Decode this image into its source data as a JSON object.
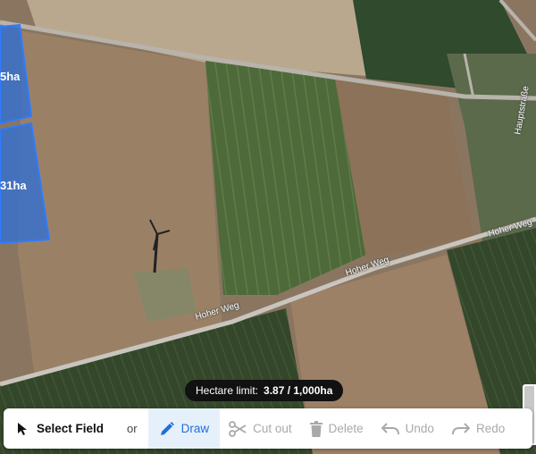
{
  "map": {
    "fields": [
      {
        "label": "5ha"
      },
      {
        "label": "31ha"
      }
    ],
    "roads": [
      {
        "label": "Hoher Weg"
      },
      {
        "label": "Hoher Weg"
      },
      {
        "label": "Hoher Weg"
      },
      {
        "label": "Hauptstraße"
      }
    ]
  },
  "hectare_limit": {
    "label": "Hectare limit:",
    "value": "3.87 / 1,000ha"
  },
  "toolbar": {
    "select_field": "Select Field",
    "or": "or",
    "draw": "Draw",
    "cut_out": "Cut out",
    "delete": "Delete",
    "undo": "Undo",
    "redo": "Redo"
  },
  "colors": {
    "accent": "#1e6fd9",
    "draw_bg": "#e6f0fb",
    "field_fill": "#2f6fd6",
    "disabled": "#a9a9a9"
  }
}
